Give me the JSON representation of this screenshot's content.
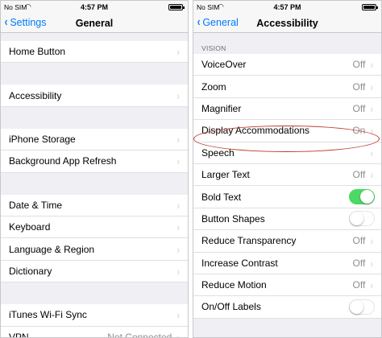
{
  "left": {
    "status": {
      "carrier": "No SIM",
      "time": "4:57 PM"
    },
    "nav": {
      "back": "Settings",
      "title": "General"
    },
    "groups": [
      [
        {
          "label": "Home Button"
        }
      ],
      [
        {
          "label": "Accessibility"
        }
      ],
      [
        {
          "label": "iPhone Storage"
        },
        {
          "label": "Background App Refresh"
        }
      ],
      [
        {
          "label": "Date & Time"
        },
        {
          "label": "Keyboard"
        },
        {
          "label": "Language & Region"
        },
        {
          "label": "Dictionary"
        }
      ],
      [
        {
          "label": "iTunes Wi-Fi Sync"
        },
        {
          "label": "VPN",
          "value": "Not Connected"
        }
      ]
    ]
  },
  "right": {
    "status": {
      "carrier": "No SIM",
      "time": "4:57 PM"
    },
    "nav": {
      "back": "General",
      "title": "Accessibility"
    },
    "section": "VISION",
    "rows": [
      {
        "label": "VoiceOver",
        "value": "Off",
        "type": "chevron"
      },
      {
        "label": "Zoom",
        "value": "Off",
        "type": "chevron"
      },
      {
        "label": "Magnifier",
        "value": "Off",
        "type": "chevron"
      },
      {
        "label": "Display Accommodations",
        "value": "On",
        "type": "chevron"
      },
      {
        "label": "Speech",
        "type": "chevron"
      },
      {
        "label": "Larger Text",
        "value": "Off",
        "type": "chevron"
      },
      {
        "label": "Bold Text",
        "type": "toggle",
        "on": true
      },
      {
        "label": "Button Shapes",
        "type": "toggle",
        "on": false
      },
      {
        "label": "Reduce Transparency",
        "value": "Off",
        "type": "chevron"
      },
      {
        "label": "Increase Contrast",
        "value": "Off",
        "type": "chevron"
      },
      {
        "label": "Reduce Motion",
        "value": "Off",
        "type": "chevron"
      },
      {
        "label": "On/Off Labels",
        "type": "toggle",
        "on": false
      }
    ]
  },
  "colors": {
    "accent": "#007aff",
    "toggle_on": "#4cd964",
    "highlight": "#c0392b"
  }
}
